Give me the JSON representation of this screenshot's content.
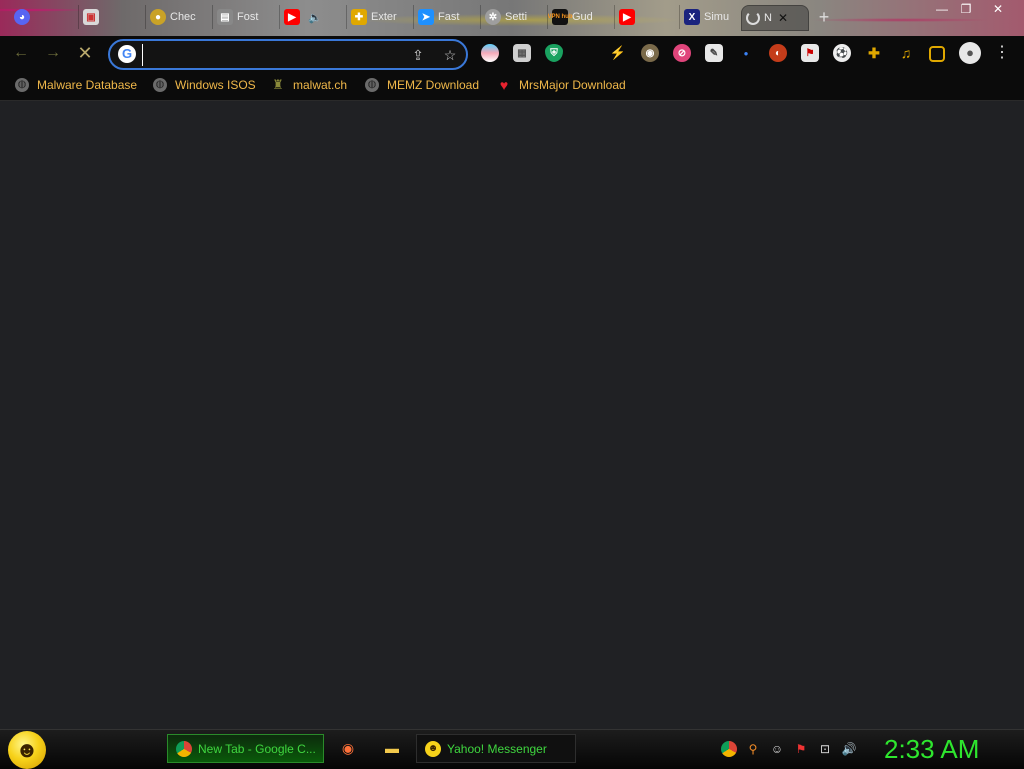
{
  "browser": {
    "tabs": [
      {
        "title": "",
        "icon": "discord-icon",
        "color": "#5865F2"
      },
      {
        "title": "",
        "icon": "gallery-icon",
        "color": "#d9d9d9"
      },
      {
        "title": "Chec",
        "icon": "coin-icon",
        "color": "#c9a227"
      },
      {
        "title": "Fost",
        "icon": "page-icon",
        "color": "#888888"
      },
      {
        "title": "",
        "icon": "youtube-icon",
        "color": "#ff0000"
      },
      {
        "title": "Exter",
        "icon": "puzzle-icon",
        "color": "#e0a800"
      },
      {
        "title": "Fast",
        "icon": "speed-icon",
        "color": "#1e90ff"
      },
      {
        "title": "Setti",
        "icon": "settings-icon",
        "color": "#9e9e9e"
      },
      {
        "title": "Gud",
        "icon": "vpnhub-icon",
        "color": "#f7941d",
        "badge": "VPN hub"
      },
      {
        "title": "",
        "icon": "youtube-icon",
        "color": "#ff0000"
      },
      {
        "title": "Simu",
        "icon": "x-icon",
        "color": "#1a237e",
        "badge": "X"
      },
      {
        "title": "N",
        "icon": "loading-icon",
        "color": "#dddddd",
        "active": true
      }
    ],
    "new_tab_symbol": "+",
    "window_controls": {
      "minimize": "—",
      "restore": "❐",
      "close": "✕"
    },
    "toolbar": {
      "back": "←",
      "forward": "→",
      "stop": "✕",
      "omnibox_value": "",
      "omnibox_google": "G",
      "share": "⇪",
      "bookmark_star": "☆",
      "extensions": [
        "translate-ext-icon",
        "photo-ext-icon",
        "shield-ext-icon",
        "bolt-ext-icon",
        "owl-ext-icon",
        "adblock-ext-icon",
        "note-ext-icon",
        "dot-ext-icon",
        "ublock-ext-icon",
        "flag-ext-icon",
        "soccer-ext-icon",
        "puzzle-ext-icon",
        "media-ext-icon",
        "sidepanel-ext-icon"
      ],
      "flag_badge": "off",
      "menu": "⋮"
    },
    "bookmarks": [
      {
        "label": "Malware Database",
        "icon": "globe-icon"
      },
      {
        "label": "Windows ISOS",
        "icon": "globe-icon"
      },
      {
        "label": "malwat.ch",
        "icon": "person-icon"
      },
      {
        "label": "MEMZ Download",
        "icon": "globe-icon"
      },
      {
        "label": "MrsMajor Download",
        "icon": "heart-icon"
      }
    ]
  },
  "taskbar": {
    "start_icon": "smiley-start-icon",
    "buttons": [
      {
        "label": "New Tab - Google C...",
        "icon": "chrome-icon",
        "active": true
      },
      {
        "label": "Yahoo! Messenger",
        "icon": "yahoo-messenger-icon",
        "active": false
      }
    ],
    "quick_launch": [
      "firefox-icon",
      "folder-icon"
    ],
    "tray": [
      "chrome-icon",
      "search-icon",
      "messenger-icon",
      "flag-icon",
      "network-icon",
      "volume-icon"
    ],
    "clock": "2:33 AM",
    "accent": "#2ee62e"
  }
}
